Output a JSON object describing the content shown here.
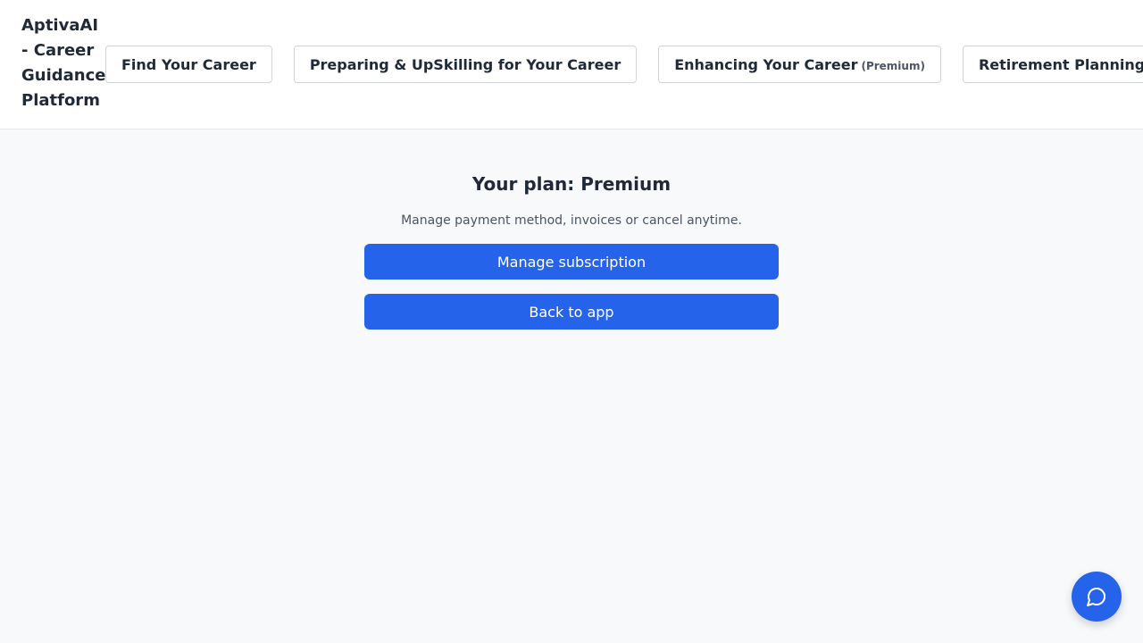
{
  "brand": {
    "title": "AptivaAI - Career Guidance Platform"
  },
  "nav": {
    "items": [
      {
        "label": "Find Your Career",
        "tag": ""
      },
      {
        "label": "Preparing & UpSkilling for Your Career",
        "tag": ""
      },
      {
        "label": "Enhancing Your Career",
        "tag": "(Premium)"
      },
      {
        "label": "Retirement Planning",
        "tag": ""
      }
    ]
  },
  "main": {
    "plan_title": "Your plan: Premium",
    "plan_subtitle": "Manage payment method, invoices or cancel anytime.",
    "manage_label": "Manage subscription",
    "back_label": "Back to app"
  },
  "chat": {
    "icon": "chat-bubble-icon"
  },
  "colors": {
    "accent": "#2563eb",
    "header_bg": "#ffffff",
    "page_bg": "#f8f9fb",
    "text": "#1f2937"
  }
}
